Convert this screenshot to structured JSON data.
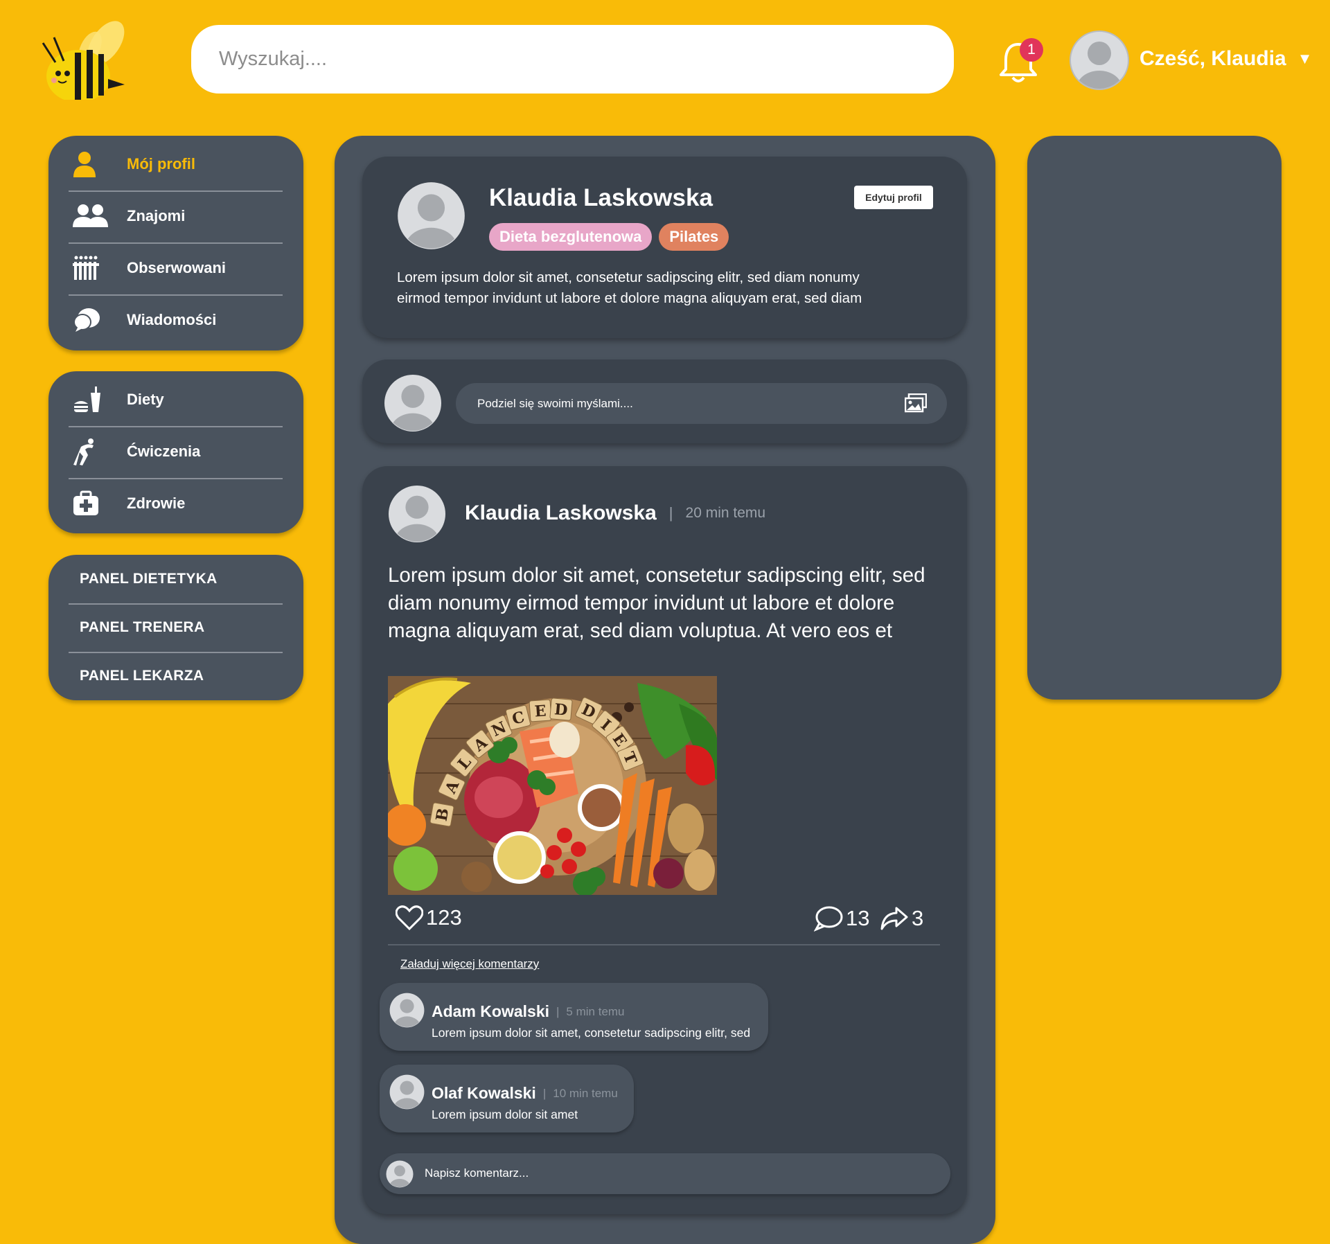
{
  "header": {
    "search_placeholder": "Wyszukaj....",
    "notification_count": "1",
    "greeting": "Cześć, Klaudia",
    "caret": "▼"
  },
  "sidebar": {
    "main": [
      {
        "label": "Mój profil",
        "icon": "user-icon",
        "active": true
      },
      {
        "label": "Znajomi",
        "icon": "friends-icon"
      },
      {
        "label": "Obserwowani",
        "icon": "followed-icon"
      },
      {
        "label": "Wiadomości",
        "icon": "messages-icon"
      }
    ],
    "health": [
      {
        "label": "Diety",
        "icon": "diet-icon"
      },
      {
        "label": "Ćwiczenia",
        "icon": "exercise-icon"
      },
      {
        "label": "Zdrowie",
        "icon": "health-kit-icon"
      }
    ],
    "panels": [
      {
        "label": "PANEL DIETETYKA"
      },
      {
        "label": "PANEL TRENERA"
      },
      {
        "label": "PANEL LEKARZA"
      }
    ]
  },
  "profile": {
    "name": "Klaudia Laskowska",
    "edit_label": "Edytuj profil",
    "tags": [
      {
        "label": "Dieta bezglutenowa",
        "color": "#e8a6c8"
      },
      {
        "label": "Pilates",
        "color": "#e0825f"
      }
    ],
    "bio_line1": "Lorem ipsum dolor sit amet, consetetur sadipscing elitr, sed diam nonumy",
    "bio_line2": "eirmod tempor invidunt ut labore et dolore magna aliquyam erat, sed diam"
  },
  "composer": {
    "placeholder": "Podziel się swoimi myślami...."
  },
  "post": {
    "author": "Klaudia Laskowska",
    "separator": "|",
    "time": "20 min temu",
    "text_line1": "Lorem ipsum dolor sit amet, consetetur sadipscing elitr, sed",
    "text_line2": "diam nonumy eirmod tempor invidunt ut labore et dolore",
    "text_line3": "magna aliquyam erat, sed diam voluptua. At vero eos et",
    "image_letters": [
      "B",
      "A",
      "L",
      "A",
      "N",
      "C",
      "E",
      "D",
      "D",
      "I",
      "E",
      "T"
    ],
    "likes": "123",
    "comments_count": "13",
    "shares": "3",
    "load_more": "Załaduj więcej komentarzy",
    "comments": [
      {
        "author": "Adam Kowalski",
        "time": "5 min temu",
        "text": "Lorem ipsum dolor sit amet, consetetur sadipscing elitr, sed"
      },
      {
        "author": "Olaf Kowalski",
        "time": "10 min temu",
        "text": "Lorem ipsum dolor sit amet"
      }
    ],
    "comment_placeholder": "Napisz komentarz..."
  },
  "colors": {
    "background": "#f9bb08",
    "panel": "#4a535e",
    "card": "#3a424c",
    "accent": "#f9bb08",
    "badge": "#e1345a"
  }
}
